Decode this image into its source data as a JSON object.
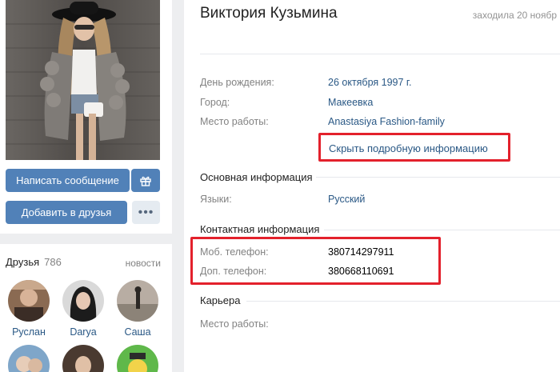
{
  "profile": {
    "name": "Виктория Кузьмина",
    "last_seen": "заходила 20 ноябр"
  },
  "actions": {
    "message_label": "Написать сообщение",
    "add_friend_label": "Добавить в друзья",
    "more_label": "•••"
  },
  "details": {
    "birthday_label": "День рождения:",
    "birthday_value": "26 октября 1997 г.",
    "city_label": "Город:",
    "city_value": "Макеевка",
    "work_label": "Место работы:",
    "work_value": "Anastasiya Fashion-family",
    "toggle_label": "Скрыть подробную информацию"
  },
  "basic": {
    "title": "Основная информация",
    "languages_label": "Языки:",
    "languages_value": "Русский"
  },
  "contacts": {
    "title": "Контактная информация",
    "mobile_label": "Моб. телефон:",
    "mobile_value": "380714297911",
    "extra_label": "Доп. телефон:",
    "extra_value": "380668110691"
  },
  "career": {
    "title": "Карьера",
    "work_label": "Место работы:"
  },
  "friends": {
    "title": "Друзья",
    "count": "786",
    "news_label": "новости",
    "items": [
      {
        "name": "Руслан"
      },
      {
        "name": "Darya"
      },
      {
        "name": "Саша"
      }
    ]
  },
  "colors": {
    "accent": "#5181b8",
    "link": "#2a5885",
    "highlight": "#e3212c"
  }
}
